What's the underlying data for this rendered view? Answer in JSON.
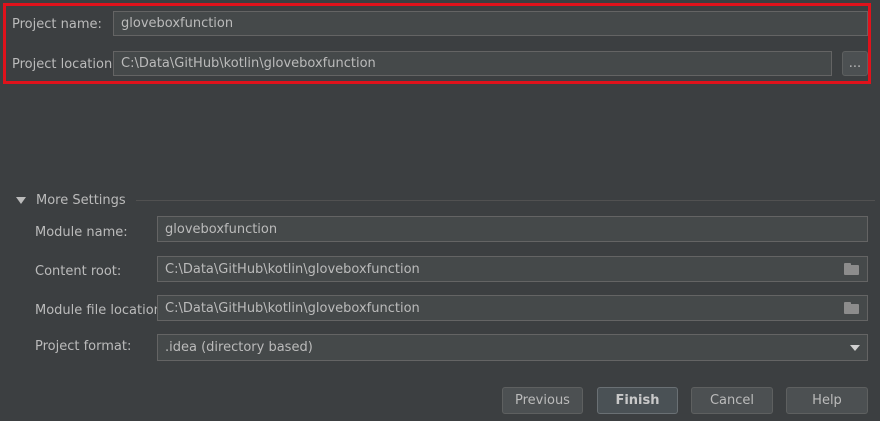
{
  "project": {
    "name_label": "Project name:",
    "name_value": "gloveboxfunction",
    "location_label": "Project location:",
    "location_value": "C:\\Data\\GitHub\\kotlin\\gloveboxfunction",
    "browse_label": "..."
  },
  "more_settings": {
    "title": "More Settings",
    "module_name_label": "Module name:",
    "module_name_value": "gloveboxfunction",
    "content_root_label": "Content root:",
    "content_root_value": "C:\\Data\\GitHub\\kotlin\\gloveboxfunction",
    "module_file_label": "Module file location:",
    "module_file_value": "C:\\Data\\GitHub\\kotlin\\gloveboxfunction",
    "format_label": "Project format:",
    "format_value": ".idea (directory based)"
  },
  "buttons": {
    "previous": "Previous",
    "finish": "Finish",
    "cancel": "Cancel",
    "help": "Help"
  },
  "colors": {
    "background": "#3c3f41",
    "field": "#45494a",
    "highlight": "#e0121b"
  },
  "icons": [
    "folder-icon",
    "expand-triangle-icon",
    "dropdown-arrow-icon"
  ]
}
